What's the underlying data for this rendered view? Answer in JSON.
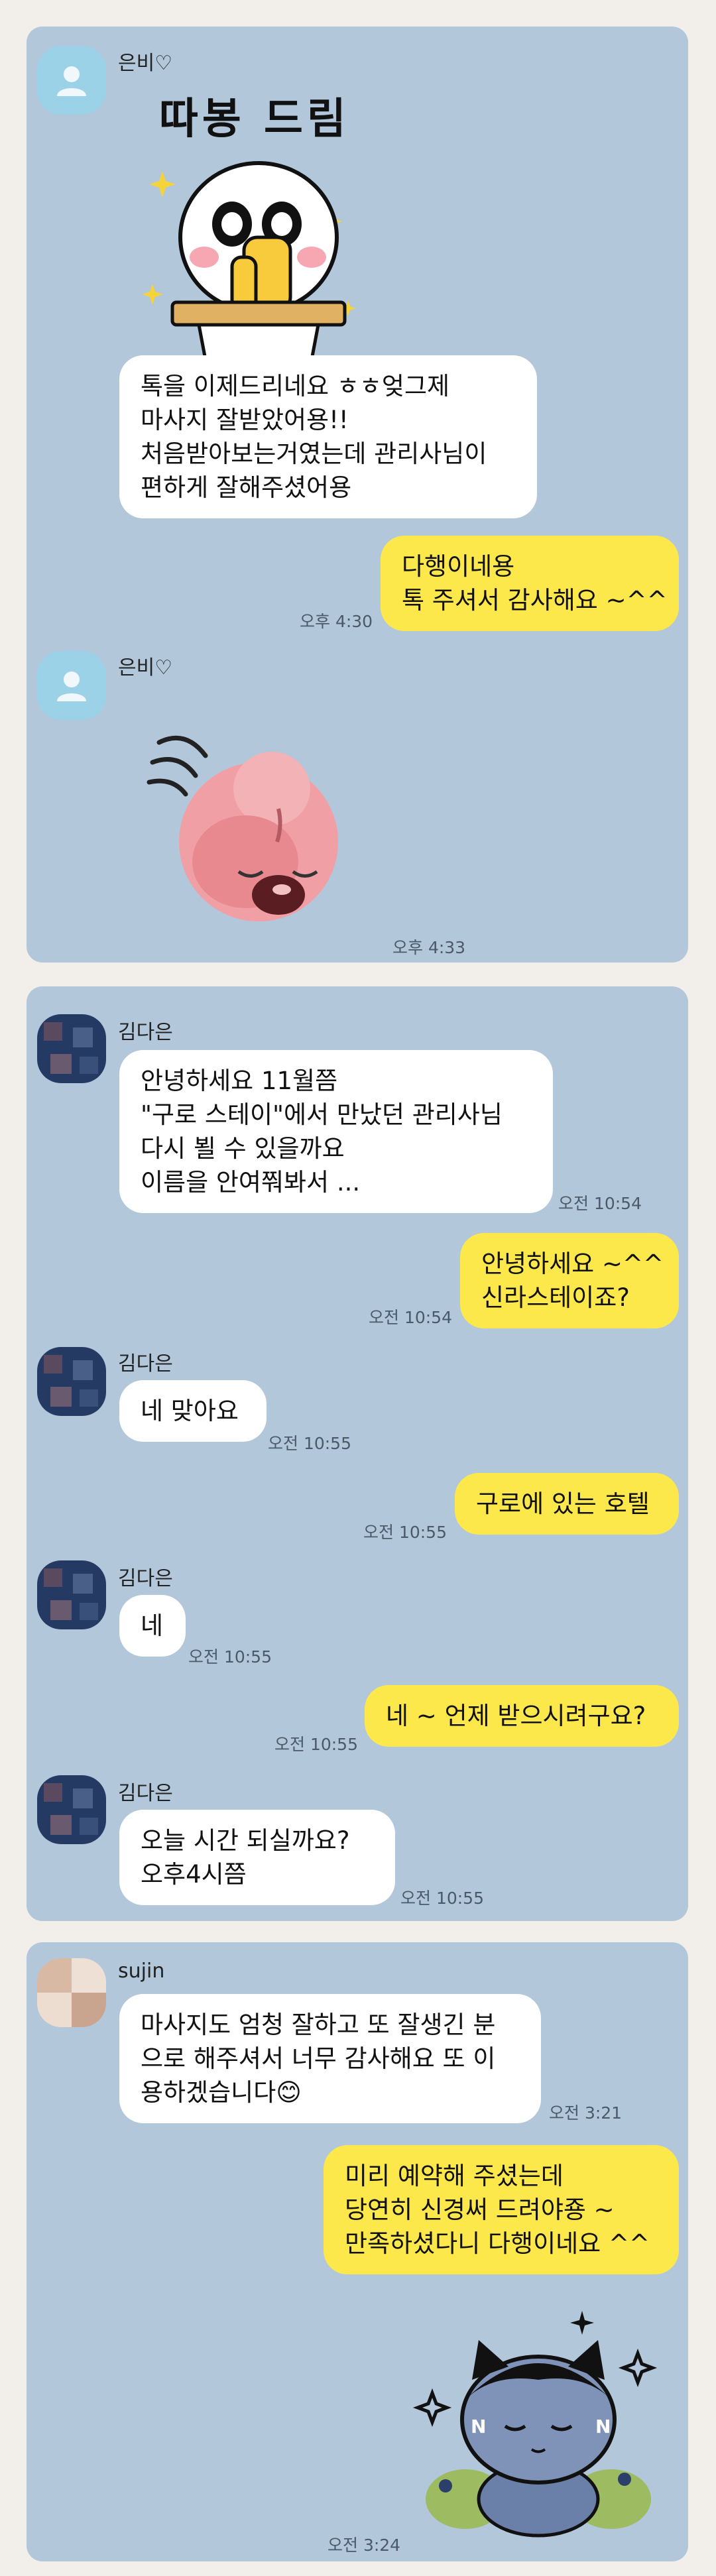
{
  "chats": [
    {
      "messages": [
        {
          "sender": "은비♡",
          "sticker_text": "따봉 드림",
          "lines": [
            "톡을 이제드리네요 ㅎㅎ엊그제",
            "마사지 잘받았어용!!",
            "처음받아보는거였는데 관리사님이",
            "편하게 잘해주셨어용"
          ]
        },
        {
          "sender": "me",
          "lines": [
            "다행이네용",
            "톡 주셔서 감사해요 ~^^"
          ],
          "time": "오후 4:30"
        },
        {
          "sender": "은비♡",
          "sticker": "sheep-bowing-sticker",
          "time": "오후 4:33"
        }
      ]
    },
    {
      "messages": [
        {
          "sender": "김다은",
          "lines": [
            "안녕하세요 11월쯤",
            "\"구로 스테이\"에서 만났던 관리사님",
            "다시 뵐 수 있을까요",
            "이름을 안여쭤봐서 ..."
          ],
          "time": "오전 10:54"
        },
        {
          "sender": "me",
          "lines": [
            "안녕하세요 ~^^",
            "신라스테이죠?"
          ],
          "time": "오전 10:54"
        },
        {
          "sender": "김다은",
          "lines": [
            "네 맞아요"
          ],
          "time": "오전 10:55"
        },
        {
          "sender": "me",
          "lines": [
            "구로에 있는 호텔"
          ],
          "time": "오전 10:55"
        },
        {
          "sender": "김다은",
          "lines": [
            "네"
          ],
          "time": "오전 10:55"
        },
        {
          "sender": "me",
          "lines": [
            "네 ~ 언제 받으시려구요?"
          ],
          "time": "오전 10:55"
        },
        {
          "sender": "김다은",
          "lines": [
            "오늘  시간 되실까요?",
            "오후4시쯤"
          ],
          "time": "오전 10:55"
        }
      ]
    },
    {
      "messages": [
        {
          "sender": "sujin",
          "lines": [
            "마사지도 엄청 잘하고 또 잘생긴 분",
            "으로 해주셔서 너무 감사해요 또 이",
            "용하겠습니다"
          ],
          "emoji": "😊",
          "time": "오전 3:21"
        },
        {
          "sender": "me",
          "lines": [
            "미리 예약해 주셨는데",
            "당연히 신경써 드려야죵 ~",
            "만족하셨다니 다행이네요 ^^"
          ]
        },
        {
          "sender": "me",
          "sticker": "cat-character-sticker",
          "time": "오전 3:24"
        }
      ]
    }
  ],
  "colors": {
    "card_bg": "#b2c7da",
    "page_bg": "#f2efeb",
    "my_bubble": "#fde84c",
    "their_bubble": "#ffffff"
  }
}
